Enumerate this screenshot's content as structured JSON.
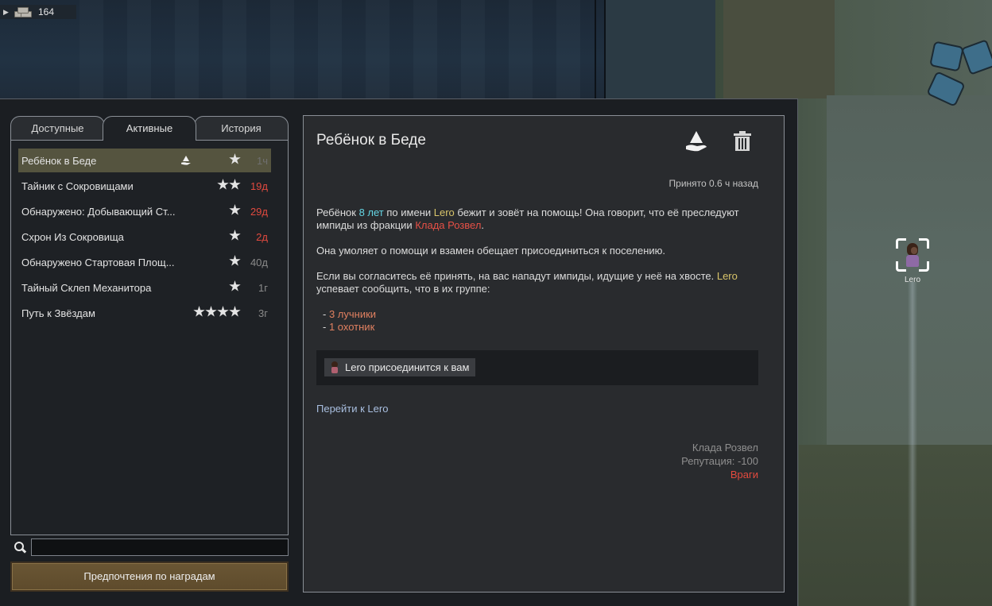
{
  "hud": {
    "resource_count": "164",
    "resource_icon": "steel-icon"
  },
  "map": {
    "pawn_name": "Lero"
  },
  "tabs": [
    {
      "label": "Доступные"
    },
    {
      "label": "Активные"
    },
    {
      "label": "История"
    }
  ],
  "active_tab": "Активные",
  "quests": [
    {
      "name": "Ребёнок в Беде",
      "stars": 1,
      "time": "1ч",
      "time_color": "#6f6f6f",
      "accepted": true,
      "selected": true
    },
    {
      "name": "Тайник с Сокровищами",
      "stars": 2,
      "time": "19д",
      "time_color": "#e14a3f"
    },
    {
      "name": "Обнаружено: Добывающий Ст...",
      "stars": 1,
      "time": "29д",
      "time_color": "#e14a3f"
    },
    {
      "name": "Схрон Из Сокровища",
      "stars": 1,
      "time": "2д",
      "time_color": "#e14a3f"
    },
    {
      "name": "Обнаружено Стартовая Площ...",
      "stars": 1,
      "time": "40д",
      "time_color": "#8a8a8a"
    },
    {
      "name": "Тайный Склеп Механитора",
      "stars": 1,
      "time": "1г",
      "time_color": "#8a8a8a"
    },
    {
      "name": "Путь к Звёздам",
      "stars": 4,
      "time": "3г",
      "time_color": "#8a8a8a"
    }
  ],
  "search": {
    "value": "",
    "placeholder": ""
  },
  "reward_prefs_label": "Предпочтения по наградам",
  "details": {
    "title": "Ребёнок в Беде",
    "accepted_time": "Принято 0.6 ч назад",
    "p1": {
      "a": "Ребёнок ",
      "age": "8 лет",
      "b": " по имени ",
      "name": "Lero",
      "c": " бежит и зовёт на помощь! Она говорит, что её преследуют импиды из фракции ",
      "faction": "Клада Розвел",
      "d": "."
    },
    "p2": "Она умоляет о помощи и взамен обещает присоединиться к поселению.",
    "p3": {
      "a": "Если вы согласитесь её принять, на вас нападут импиды, идущие у неё на хвосте. ",
      "name": "Lero",
      "b": " успевает сообщить, что в их группе:"
    },
    "list": [
      {
        "dash": "- ",
        "text": "3 лучники"
      },
      {
        "dash": "- ",
        "text": "1 охотник"
      }
    ],
    "reward": "Lero присоединится к вам",
    "goto_link": "Перейти к Lero",
    "faction": {
      "name": "Клада Розвел",
      "reputation": "Репутация: -100",
      "status": "Враги"
    }
  }
}
